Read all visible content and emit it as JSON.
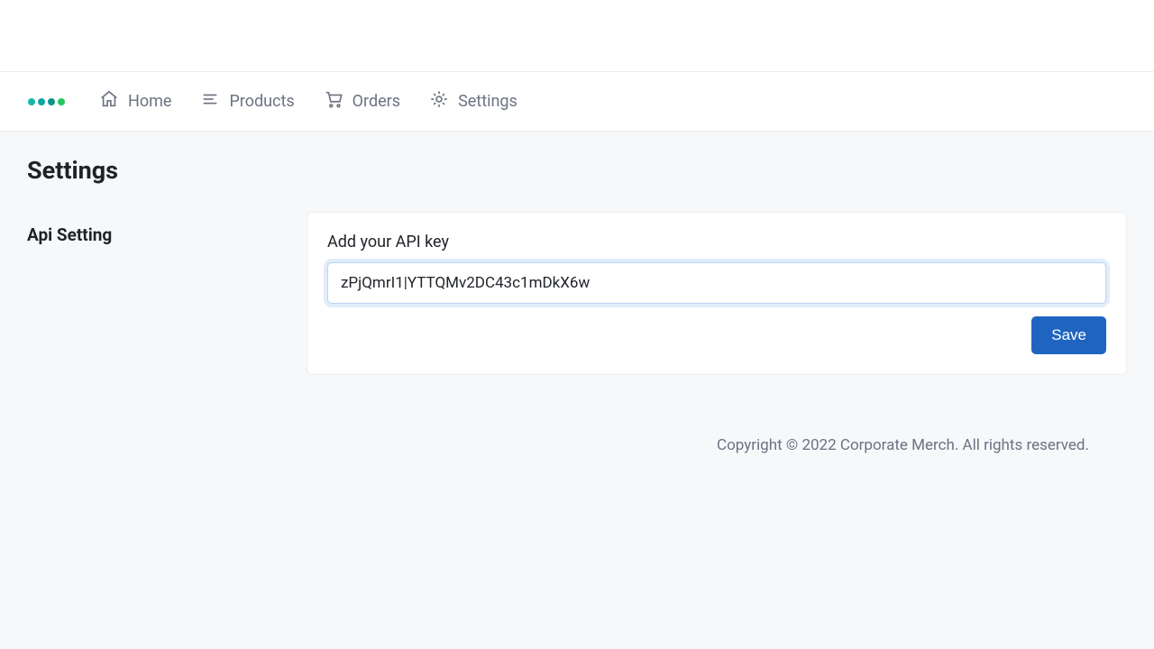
{
  "nav": {
    "items": [
      {
        "label": "Home"
      },
      {
        "label": "Products"
      },
      {
        "label": "Orders"
      },
      {
        "label": "Settings"
      }
    ]
  },
  "page": {
    "title": "Settings",
    "section_label": "Api Setting"
  },
  "form": {
    "api_label": "Add your API key",
    "api_value": "zPjQmrI1|YTTQMv2DC43c1mDkX6w",
    "save_label": "Save"
  },
  "footer": {
    "text": "Copyright © 2022 Corporate Merch. All rights reserved."
  }
}
